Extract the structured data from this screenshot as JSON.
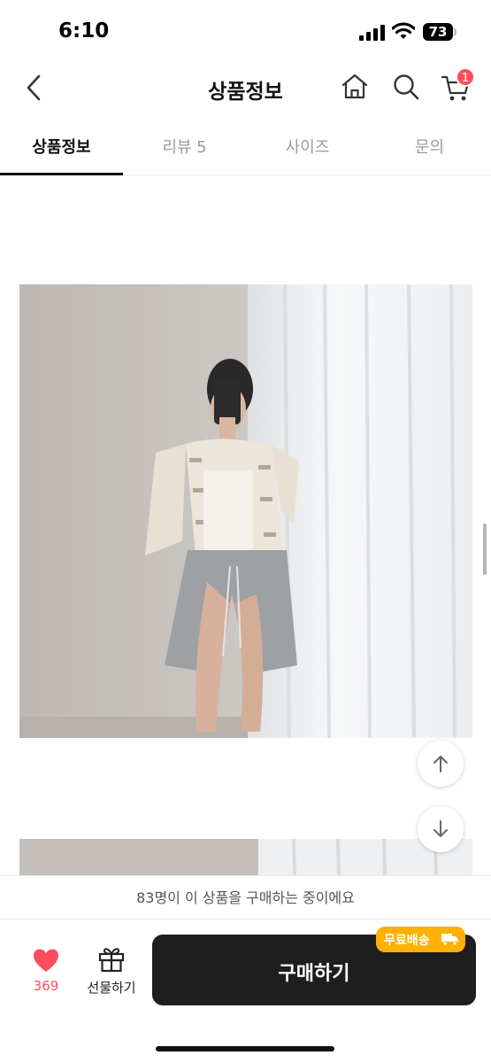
{
  "status_bar": {
    "time": "6:10",
    "battery": "73"
  },
  "header": {
    "title": "상품정보",
    "cart_count": "1"
  },
  "tabs": [
    {
      "label": "상품정보"
    },
    {
      "label": "리뷰 5"
    },
    {
      "label": "사이즈"
    },
    {
      "label": "문의"
    }
  ],
  "notice": {
    "text": "83명이 이 상품을 구매하는 중이에요"
  },
  "bottom": {
    "like_count": "369",
    "gift_label": "선물하기",
    "buy_label": "구매하기",
    "shipping_badge": "무료배송"
  },
  "icons": [
    "back-icon",
    "home-icon",
    "search-icon",
    "cart-icon",
    "scroll-up-icon",
    "scroll-down-icon",
    "heart-icon",
    "gift-icon",
    "truck-icon"
  ],
  "colors": {
    "accent": "#ff4d5e",
    "badge": "#ffb000",
    "button": "#1e1e1e"
  }
}
